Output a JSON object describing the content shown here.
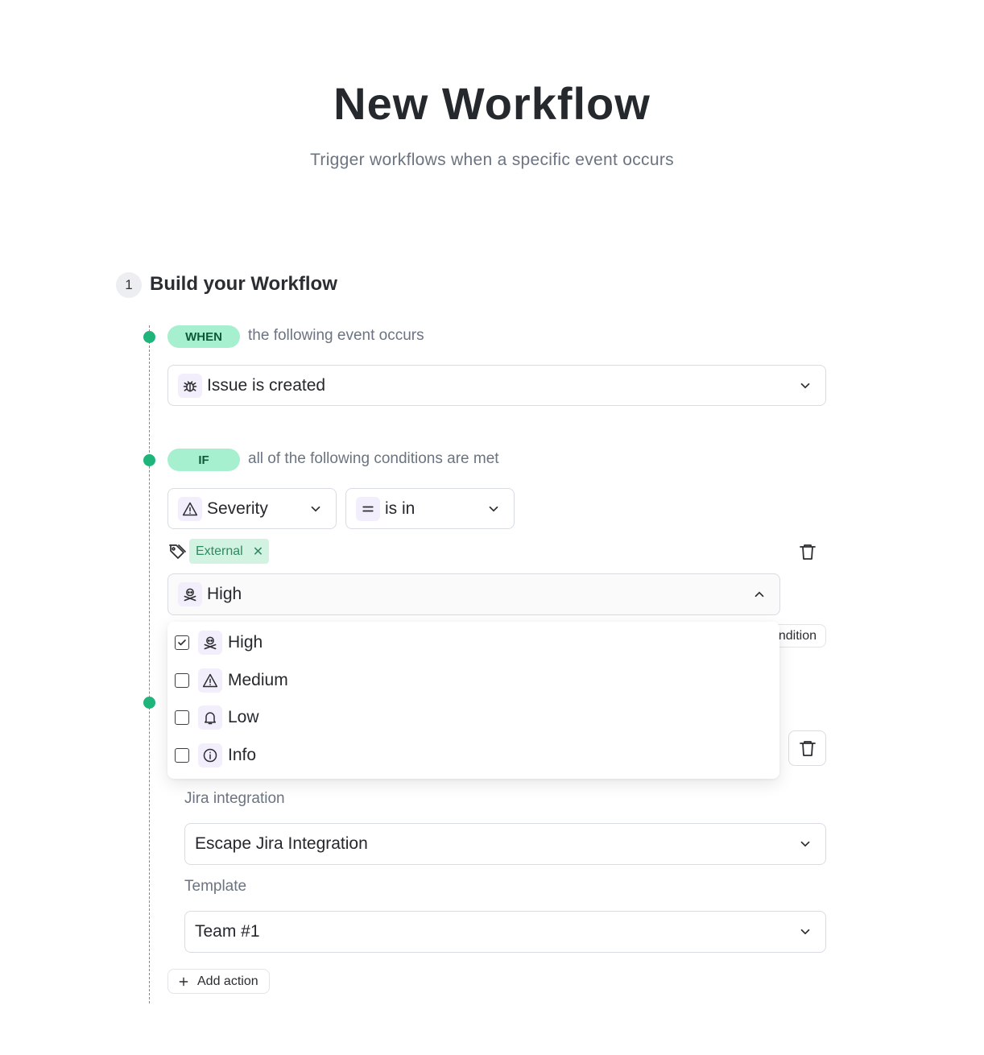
{
  "header": {
    "title": "New Workflow",
    "subtitle": "Trigger workflows when a specific event occurs"
  },
  "step": {
    "number": "1",
    "title": "Build your Workflow"
  },
  "when": {
    "pill": "WHEN",
    "description": "the following event occurs",
    "event_select": {
      "icon": "bug-icon",
      "value": "Issue is created"
    }
  },
  "if": {
    "pill": "IF",
    "description": "all of the following conditions are met",
    "field_select": {
      "icon": "warning-triangle-icon",
      "value": "Severity"
    },
    "operator_select": {
      "icon": "equals-icon",
      "value": "is in"
    },
    "tag_chip": "External",
    "values_select": {
      "icon": "skull-icon",
      "value": "High"
    },
    "add_condition_label": "Add condition",
    "add_condition_visible": "ndition"
  },
  "dropdown": {
    "options": [
      {
        "label": "High",
        "icon": "skull-icon",
        "checked": true
      },
      {
        "label": "Medium",
        "icon": "warning-triangle-icon",
        "checked": false
      },
      {
        "label": "Low",
        "icon": "bell-icon",
        "checked": false
      },
      {
        "label": "Info",
        "icon": "info-circle-icon",
        "checked": false
      }
    ]
  },
  "then": {
    "jira_label": "Jira integration",
    "jira_select": "Escape Jira Integration",
    "template_label": "Template",
    "template_select": "Team #1",
    "add_action": "Add action"
  },
  "colors": {
    "accent_green": "#1fb57a",
    "pill_bg": "#a7f0cf",
    "icon_bg": "#f3eefb",
    "chip_bg": "#d2f3e2"
  }
}
